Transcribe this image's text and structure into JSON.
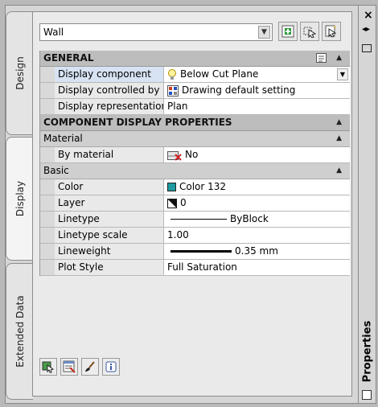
{
  "tabs": {
    "design": "Design",
    "display": "Display",
    "extended": "Extended Data"
  },
  "object_type": "Wall",
  "sections": {
    "general": {
      "title": "GENERAL",
      "rows": [
        {
          "name": "Display component",
          "value": "Below Cut Plane"
        },
        {
          "name": "Display controlled by",
          "value": "Drawing default setting"
        },
        {
          "name": "Display representation",
          "value": "Plan"
        }
      ]
    },
    "component": {
      "title": "COMPONENT DISPLAY PROPERTIES",
      "material": {
        "title": "Material",
        "row": {
          "name": "By material",
          "value": "No"
        }
      },
      "basic": {
        "title": "Basic",
        "rows": [
          {
            "name": "Color",
            "value": "Color 132"
          },
          {
            "name": "Layer",
            "value": "0"
          },
          {
            "name": "Linetype",
            "value": "ByBlock"
          },
          {
            "name": "Linetype scale",
            "value": "1.00"
          },
          {
            "name": "Lineweight",
            "value": "0.35 mm"
          },
          {
            "name": "Plot Style",
            "value": "Full Saturation"
          }
        ]
      }
    }
  },
  "palette_title": "Properties",
  "colors": {
    "color132": "#1e9aa0"
  }
}
